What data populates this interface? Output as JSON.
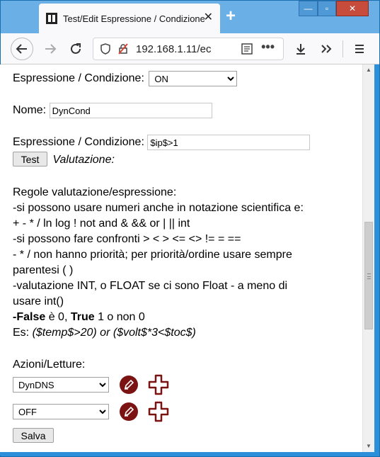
{
  "browser": {
    "tab_title": "Test/Edit Espressione / Condizione",
    "tab_close": "✕",
    "new_tab": "+",
    "url": "192.168.1.11/ec",
    "window_controls": {
      "minimize": "—",
      "maximize": "▫",
      "close": "✕"
    }
  },
  "form": {
    "type_label": "Espressione / Condizione:",
    "type_value": "ON",
    "name_label": "Nome:",
    "name_value": "DynCond",
    "expr_label": "Espressione / Condizione:",
    "expr_value": "$ip$>1",
    "test_button": "Test",
    "evaluation_label": "Valutazione:"
  },
  "rules": {
    "heading": "Regole valutazione/espressione:",
    "line1": "-si possono usare numeri anche in notazione scientifica e:",
    "line2": "+ - * / ln log ! not and & && or | || int",
    "line3": "-si possono fare confronti > < > <= <> != = ==",
    "line4": "- * / non hanno priorità; per priorità/ordine usare sempre",
    "line5": "parentesi ( )",
    "line6": "-valutazione INT, o FLOAT se ci sono Float - a meno di",
    "line7": "usare int()",
    "false_prefix": "-",
    "false_word": "False",
    "false_rest": " è 0, ",
    "true_word": "True",
    "true_rest": " 1 o non 0",
    "example_prefix": "Es: ",
    "example_a": "($temp$>20)",
    "example_or": " or ",
    "example_b": "($volt$*3<$toc$)"
  },
  "actions": {
    "heading": "Azioni/Letture:",
    "items": [
      {
        "value": "DynDNS"
      },
      {
        "value": "OFF"
      }
    ],
    "save_button": "Salva"
  },
  "colors": {
    "edit_icon_bg": "#7b1313",
    "plus_icon": "#7b1313"
  }
}
